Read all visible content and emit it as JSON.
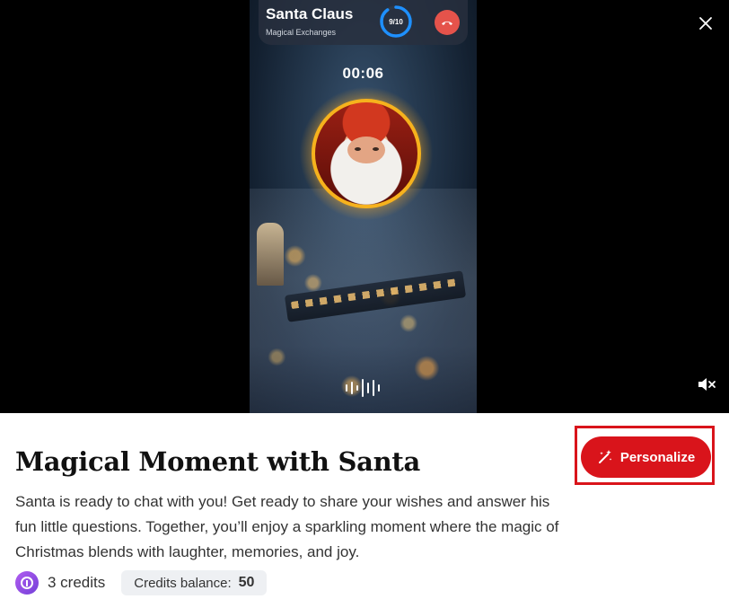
{
  "video": {
    "caller_name": "Santa Claus",
    "caller_subtitle": "Magical Exchanges",
    "progress_label": "9/10",
    "progress_fraction": 0.9,
    "timer": "00:06",
    "icons": {
      "hangup": "phone-hangup-icon",
      "close": "close-icon",
      "mute": "volume-mute-icon",
      "voice": "sound-wave-icon"
    }
  },
  "details": {
    "title": "Magical Moment with Santa",
    "description": "Santa is ready to chat with you! Get ready to share your wishes and answer his fun little questions. Together, you’ll enjoy a sparkling moment where the magic of Christmas blends with laughter, memories, and joy.",
    "credits_label": "3 credits",
    "balance_label": "Credits balance:",
    "balance_value": "50"
  },
  "actions": {
    "personalize_label": "Personalize"
  },
  "colors": {
    "accent_red": "#d9141b",
    "hangup_red": "#e5534b",
    "ring_blue": "#1e90ff",
    "credits_purple": "#8e4ce6"
  }
}
